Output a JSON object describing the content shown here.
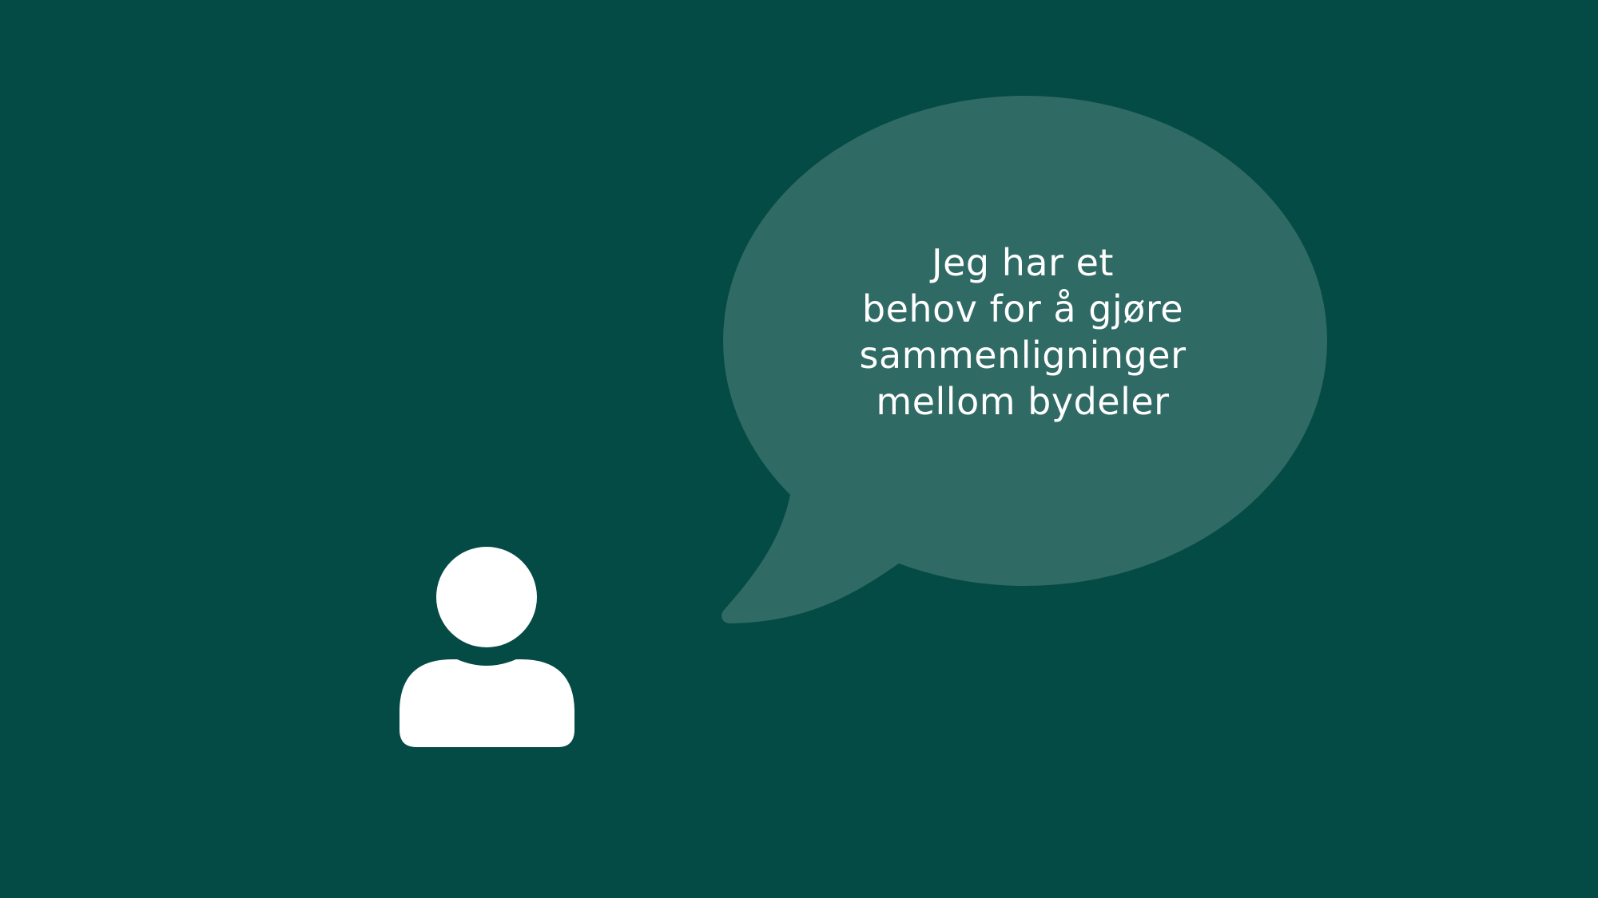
{
  "speech": {
    "lines": [
      "Jeg har et",
      "behov for å gjøre",
      "sammenligninger",
      "mellom bydeler"
    ]
  },
  "icons": {
    "person": "person-icon",
    "speech_bubble": "speech-bubble"
  },
  "colors": {
    "background": "#054b45",
    "bubble": "#306a64",
    "icon": "#ffffff",
    "text": "#ffffff"
  }
}
